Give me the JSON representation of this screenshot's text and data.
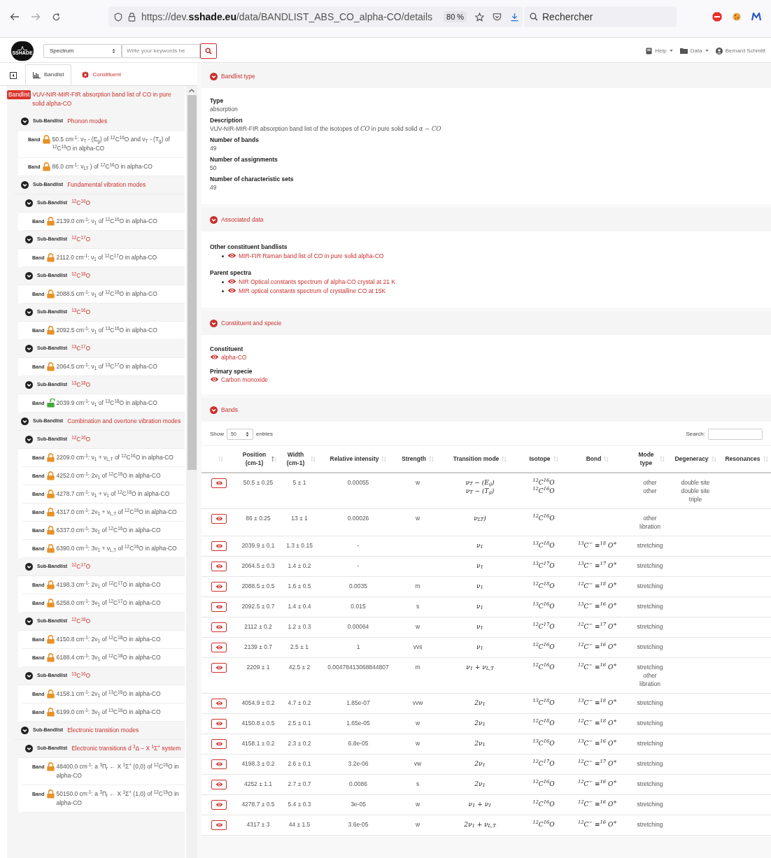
{
  "browser": {
    "url": "https://dev.**sshade.eu**/data/BANDLIST_ABS_CO_alpha-CO/details",
    "zoom": "80 %",
    "search_placeholder": "Rechercher"
  },
  "app_header": {
    "logo_text": "SSHADE",
    "search_scope": "Spectrum",
    "search_placeholder": "Write your keywords he",
    "menus": [
      "Help",
      "Data"
    ],
    "user": "Bernard Schmitt"
  },
  "tabs": [
    {
      "label": "Bandlist",
      "selected": true
    },
    {
      "label": "Constituent",
      "selected": false
    }
  ],
  "sidebar": {
    "root": {
      "kind": "bandlist",
      "label": "Bandlist",
      "title": "VUV-NIR-MIR-FIR absorption band list of CO in pure solid alpha-CO",
      "children": [
        {
          "kind": "subbandlist",
          "label": "Sub-Bandlist",
          "title": "Phonon modes",
          "children": [
            {
              "kind": "band",
              "label": "Band",
              "locked": true,
              "text": "50.5 cm$^{-1}$: ν$_{T}$ - (E$_{g}$) of $^{12}$C$^{16}$O and ν$_{T}$ - (T$_{g}$) of $^{12}$C$^{16}$O in alpha-CO"
            },
            {
              "kind": "band",
              "label": "Band",
              "locked": true,
              "text": "86.0 cm$^{-1}$: ν$_{LT}$ ) of $^{12}$C$^{16}$O in alpha-CO"
            }
          ]
        },
        {
          "kind": "subbandlist",
          "label": "Sub-Bandlist",
          "title": "Fundamental vibration modes",
          "children": [
            {
              "kind": "subbandlist",
              "label": "Sub-Bandlist",
              "title": "$^{12}$C$^{16}$O",
              "children": [
                {
                  "kind": "band",
                  "label": "Band",
                  "locked": true,
                  "text": "2139.0 cm$^{-1}$: ν$_{1}$ of $^{12}$C$^{16}$O in alpha-CO"
                }
              ]
            },
            {
              "kind": "subbandlist",
              "label": "Sub-Bandlist",
              "title": "$^{12}$C$^{17}$O",
              "children": [
                {
                  "kind": "band",
                  "label": "Band",
                  "locked": true,
                  "text": "2112.0 cm$^{-1}$: ν$_{1}$ of $^{12}$C$^{17}$O in alpha-CO"
                }
              ]
            },
            {
              "kind": "subbandlist",
              "label": "Sub-Bandlist",
              "title": "$^{12}$C$^{18}$O",
              "children": [
                {
                  "kind": "band",
                  "label": "Band",
                  "locked": true,
                  "text": "2088.5 cm$^{-1}$: ν$_{1}$ of $^{12}$C$^{18}$O in alpha-CO"
                }
              ]
            },
            {
              "kind": "subbandlist",
              "label": "Sub-Bandlist",
              "title": "$^{13}$C$^{16}$O",
              "children": [
                {
                  "kind": "band",
                  "label": "Band",
                  "locked": true,
                  "text": "2092.5 cm$^{-1}$: ν$_{1}$ of $^{13}$C$^{16}$O in alpha-CO"
                }
              ]
            },
            {
              "kind": "subbandlist",
              "label": "Sub-Bandlist",
              "title": "$^{13}$C$^{17}$O",
              "children": [
                {
                  "kind": "band",
                  "label": "Band",
                  "locked": true,
                  "text": "2064.5 cm$^{-1}$: ν$_{1}$ of $^{13}$C$^{17}$O in alpha-CO"
                }
              ]
            },
            {
              "kind": "subbandlist",
              "label": "Sub-Bandlist",
              "title": "$^{13}$C$^{18}$O",
              "children": [
                {
                  "kind": "band",
                  "label": "Band",
                  "locked": false,
                  "text": "2039.9 cm$^{-1}$: ν$_{1}$ of $^{13}$C$^{18}$O in alpha-CO"
                }
              ]
            }
          ]
        },
        {
          "kind": "subbandlist",
          "label": "Sub-Bandlist",
          "title": "Combination and overtone vibration modes",
          "children": [
            {
              "kind": "subbandlist",
              "label": "Sub-Bandlist",
              "title": "$^{12}$C$^{16}$O",
              "children": [
                {
                  "kind": "band",
                  "label": "Band",
                  "locked": true,
                  "text": "2209.0 cm$^{-1}$: ν$_{1}$ + ν$_{L,T}$ of $^{12}$C$^{16}$O in alpha-CO"
                },
                {
                  "kind": "band",
                  "label": "Band",
                  "locked": true,
                  "text": "4252.0 cm$^{-1}$: 2ν$_{1}$ of $^{12}$C$^{16}$O in alpha-CO"
                },
                {
                  "kind": "band",
                  "label": "Band",
                  "locked": true,
                  "text": "4278.7 cm$^{-1}$: ν$_{1}$ + ν$_{1}$ of $^{12}$C$^{16}$O in alpha-CO"
                },
                {
                  "kind": "band",
                  "label": "Band",
                  "locked": true,
                  "text": "4317.0 cm$^{-1}$: 2ν$_{1}$ + ν$_{L,T}$ of $^{12}$C$^{16}$O in alpha-CO"
                },
                {
                  "kind": "band",
                  "label": "Band",
                  "locked": true,
                  "text": "6337.0 cm$^{-1}$: 3ν$_{1}$ of $^{12}$C$^{16}$O in alpha-CO"
                },
                {
                  "kind": "band",
                  "label": "Band",
                  "locked": true,
                  "text": "6390.0 cm$^{-1}$: 3ν$_{1}$ + ν$_{L,T}$ of $^{12}$C$^{16}$O in alpha-CO"
                }
              ]
            },
            {
              "kind": "subbandlist",
              "label": "Sub-Bandlist",
              "title": "$^{12}$C$^{17}$O",
              "children": [
                {
                  "kind": "band",
                  "label": "Band",
                  "locked": true,
                  "text": "4198.3 cm$^{-1}$: 2ν$_{1}$ of $^{12}$C$^{17}$O in alpha-CO"
                },
                {
                  "kind": "band",
                  "label": "Band",
                  "locked": true,
                  "text": "6258.0 cm$^{-1}$: 3ν$_{1}$ of $^{12}$C$^{17}$O in alpha-CO"
                }
              ]
            },
            {
              "kind": "subbandlist",
              "label": "Sub-Bandlist",
              "title": "$^{12}$C$^{18}$O",
              "children": [
                {
                  "kind": "band",
                  "label": "Band",
                  "locked": true,
                  "text": "4150.8 cm$^{-1}$: 2ν$_{1}$ of $^{12}$C$^{18}$O in alpha-CO"
                },
                {
                  "kind": "band",
                  "label": "Band",
                  "locked": true,
                  "text": "6188.4 cm$^{-1}$: 3ν$_{1}$ of $^{12}$C$^{18}$O in alpha-CO"
                }
              ]
            },
            {
              "kind": "subbandlist",
              "label": "Sub-Bandlist",
              "title": "$^{13}$C$^{16}$O",
              "children": [
                {
                  "kind": "band",
                  "label": "Band",
                  "locked": true,
                  "text": "4158.1 cm$^{-1}$: 2ν$_{1}$ of $^{13}$C$^{16}$O in alpha-CO"
                },
                {
                  "kind": "band",
                  "label": "Band",
                  "locked": true,
                  "text": "6199.0 cm$^{-1}$: 3ν$_{1}$ of $^{13}$C$^{16}$O in alpha-CO"
                }
              ]
            }
          ]
        },
        {
          "kind": "subbandlist",
          "label": "Sub-Bandlist",
          "title": "Electronic transition modes",
          "children": [
            {
              "kind": "subbandlist",
              "label": "Sub-Bandlist",
              "title": "Electronic transitions d $^{3}$Δ − X $^{1}$Σ$^{+}$ system",
              "children": [
                {
                  "kind": "band",
                  "label": "Band",
                  "locked": true,
                  "text": "48400.0 cm$^{-1}$: a $^{3}$Π$_{r}$ ← X $^{1}$Σ$^{+}$ (0,0) of $^{12}$C$^{16}$O in alpha-CO"
                },
                {
                  "kind": "band",
                  "label": "Band",
                  "locked": true,
                  "text": "50150.0 cm$^{-1}$: a $^{3}$Π$_{r}$ ← X $^{1}$Σ$^{+}$ (1,0) of $^{12}$C$^{16}$O in alpha-CO"
                }
              ]
            }
          ]
        }
      ]
    }
  },
  "sections": [
    {
      "kind": "fields",
      "title": "Bandlist type",
      "fields": [
        {
          "label": "Type",
          "value": "absorption"
        },
        {
          "label": "Description",
          "value": "VUV-NIR-MIR-FIR absorption band list of the isotopes of *CO* in pure solid solid *α − CO*"
        },
        {
          "label": "Number of bands",
          "value": "49"
        },
        {
          "label": "Number of assignments",
          "value": "50"
        },
        {
          "label": "Number of characteristic sets",
          "value": "49"
        }
      ]
    },
    {
      "kind": "link_groups",
      "title": "Associated data",
      "groups": [
        {
          "label": "Other constituent bandlists",
          "links": [
            "MIR-FIR Raman band list of CO in pure solid alpha-CO"
          ]
        },
        {
          "label": "Parent spectra",
          "links": [
            "NIR Optical constants spectrum of alpha-CO crystal at 21 K",
            "MIR optical constants spectrum of crystalline CO at 15K"
          ]
        }
      ]
    },
    {
      "kind": "link_fields",
      "title": "Constituent and specie",
      "fields": [
        {
          "label": "Constituent",
          "link": "alpha-CO"
        },
        {
          "label": "Primary specie",
          "link": "Carbon monoxide"
        }
      ]
    },
    {
      "kind": "table",
      "title": "Bands",
      "show_label": "Show",
      "page_length": "50",
      "entries_label": "entries",
      "search_label": "Search:",
      "columns": [
        {
          "sorted": false
        },
        {
          "label": "Position (cm-1)",
          "sorted": true
        },
        {
          "label": "Width (cm-1)",
          "sorted": false
        },
        {
          "label": "Relative intensity",
          "sorted": false
        },
        {
          "label": "Strength",
          "sorted": false
        },
        {
          "label": "Transition mode",
          "sorted": false
        },
        {
          "label": "Isotope",
          "sorted": false
        },
        {
          "label": "Bond",
          "sorted": false
        },
        {
          "label": "Mode type",
          "sorted": false
        },
        {
          "label": "Degeneracy",
          "sorted": false
        },
        {
          "label": "Resonances",
          "sorted": false
        }
      ],
      "rows": [
        {
          "position": [
            "50.5 ± 0.25"
          ],
          "width": [
            "5 ± 1"
          ],
          "intensity": [
            "0.00055"
          ],
          "strength": [
            "w"
          ],
          "transition": [
            "ν$_{T}$ − (E$_{g}$)",
            "ν$_{T}$ − (T$_{g}$)"
          ],
          "isotope": [
            "$^{12}$C$^{16}$O",
            "$^{12}$C$^{16}$O"
          ],
          "mode_type": [
            "other",
            "other"
          ],
          "degeneracy": [
            "double site",
            "double site",
            "triple"
          ]
        },
        {
          "position": [
            "86 ± 0.25"
          ],
          "width": [
            "13 ± 1"
          ],
          "intensity": [
            "0.00026"
          ],
          "strength": [
            "w"
          ],
          "transition": [
            "ν$_{LT}$)"
          ],
          "isotope": [
            "$^{12}$C$^{16}$O"
          ],
          "mode_type": [
            "other",
            "libration"
          ]
        },
        {
          "position": [
            "2039.9 ± 0.1"
          ],
          "width": [
            "1.3 ± 0.15"
          ],
          "intensity": [
            "-"
          ],
          "transition": [
            "ν$_{1}$"
          ],
          "isotope": [
            "$^{13}$C$^{18}$O"
          ],
          "bond": [
            "$^{13}$C$^{−}$ ≡$^{18}$ O$^{+}$"
          ],
          "mode_type": [
            "stretching"
          ]
        },
        {
          "position": [
            "2064.5 ± 0.3"
          ],
          "width": [
            "1.4 ± 0.2"
          ],
          "intensity": [
            "-"
          ],
          "transition": [
            "ν$_{1}$"
          ],
          "isotope": [
            "$^{13}$C$^{17}$O"
          ],
          "bond": [
            "$^{13}$C$^{−}$ ≡$^{17}$ O$^{+}$"
          ],
          "mode_type": [
            "stretching"
          ]
        },
        {
          "position": [
            "2088.5 ± 0.5"
          ],
          "width": [
            "1.6 ± 0.5"
          ],
          "intensity": [
            "0.0035"
          ],
          "strength": [
            "m"
          ],
          "transition": [
            "ν$_{1}$"
          ],
          "isotope": [
            "$^{12}$C$^{18}$O"
          ],
          "bond": [
            "$^{12}$C$^{−}$ ≡$^{18}$ O$^{+}$"
          ],
          "mode_type": [
            "stretching"
          ]
        },
        {
          "position": [
            "2092.5 ± 0.7"
          ],
          "width": [
            "1.4 ± 0.4"
          ],
          "intensity": [
            "0.015"
          ],
          "strength": [
            "s"
          ],
          "transition": [
            "ν$_{1}$"
          ],
          "isotope": [
            "$^{13}$C$^{16}$O"
          ],
          "bond": [
            "$^{13}$C$^{−}$ ≡$^{16}$ O$^{+}$"
          ],
          "mode_type": [
            "stretching"
          ]
        },
        {
          "position": [
            "2112 ± 0.2"
          ],
          "width": [
            "1.2 ± 0.3"
          ],
          "intensity": [
            "0.00064"
          ],
          "strength": [
            "w"
          ],
          "transition": [
            "ν$_{1}$"
          ],
          "isotope": [
            "$^{12}$C$^{17}$O"
          ],
          "bond": [
            "$^{12}$C$^{−}$ ≡$^{17}$ O$^{+}$"
          ],
          "mode_type": [
            "stretching"
          ]
        },
        {
          "position": [
            "2139 ± 0.7"
          ],
          "width": [
            "2.5 ± 1"
          ],
          "intensity": [
            "1"
          ],
          "strength": [
            "vvs"
          ],
          "transition": [
            "ν$_{1}$"
          ],
          "isotope": [
            "$^{12}$C$^{16}$O"
          ],
          "bond": [
            "$^{12}$C$^{−}$ ≡$^{16}$ O$^{+}$"
          ],
          "mode_type": [
            "stretching"
          ]
        },
        {
          "position": [
            "2209 ± 1"
          ],
          "width": [
            "42.5 ± 2"
          ],
          "intensity": [
            "0.00478413068844807"
          ],
          "strength": [
            "m"
          ],
          "transition": [
            "ν$_{1}$ + ν$_{L,T}$"
          ],
          "isotope": [
            "$^{12}$C$^{16}$O"
          ],
          "bond": [
            "$^{12}$C$^{−}$ ≡$^{16}$ O$^{+}$"
          ],
          "mode_type": [
            "stretching",
            "other",
            "libration"
          ]
        },
        {
          "position": [
            "4054.9 ± 0.2"
          ],
          "width": [
            "4.7 ± 0.2"
          ],
          "intensity": [
            "1.85e-07"
          ],
          "strength": [
            "vvw"
          ],
          "transition": [
            "2ν$_{1}$"
          ],
          "isotope": [
            "$^{13}$C$^{18}$O"
          ],
          "bond": [
            "$^{13}$C$^{−}$ ≡$^{18}$ O$^{+}$"
          ],
          "mode_type": [
            "stretching"
          ]
        },
        {
          "position": [
            "4150.8 ± 0.5"
          ],
          "width": [
            "2.5 ± 0.1"
          ],
          "intensity": [
            "1.65e-05"
          ],
          "strength": [
            "w"
          ],
          "transition": [
            "2ν$_{1}$"
          ],
          "isotope": [
            "$^{12}$C$^{18}$O"
          ],
          "bond": [
            "$^{12}$C$^{−}$ ≡$^{18}$ O$^{+}$"
          ],
          "mode_type": [
            "stretching"
          ]
        },
        {
          "position": [
            "4158.1 ± 0.2"
          ],
          "width": [
            "2.3 ± 0.2"
          ],
          "intensity": [
            "6.8e-05"
          ],
          "strength": [
            "w"
          ],
          "transition": [
            "2ν$_{1}$"
          ],
          "isotope": [
            "$^{13}$C$^{16}$O"
          ],
          "bond": [
            "$^{13}$C$^{−}$ ≡$^{16}$ O$^{+}$"
          ],
          "mode_type": [
            "stretching"
          ]
        },
        {
          "position": [
            "4198.3 ± 0.2"
          ],
          "width": [
            "2.6 ± 0.1"
          ],
          "intensity": [
            "3.2e-06"
          ],
          "strength": [
            "vw"
          ],
          "transition": [
            "2ν$_{1}$"
          ],
          "isotope": [
            "$^{12}$C$^{17}$O"
          ],
          "bond": [
            "$^{12}$C$^{−}$ ≡$^{17}$ O$^{+}$"
          ],
          "mode_type": [
            "stretching"
          ]
        },
        {
          "position": [
            "4252 ± 1.1"
          ],
          "width": [
            "2.7 ± 0.7"
          ],
          "intensity": [
            "0.0086"
          ],
          "strength": [
            "s"
          ],
          "transition": [
            "2ν$_{1}$"
          ],
          "isotope": [
            "$^{12}$C$^{16}$O"
          ],
          "bond": [
            "$^{12}$C$^{−}$ ≡$^{16}$ O$^{+}$"
          ],
          "mode_type": [
            "stretching"
          ]
        },
        {
          "position": [
            "4278.7 ± 0.5"
          ],
          "width": [
            "5.4 ± 0.3"
          ],
          "intensity": [
            "3e-05"
          ],
          "strength": [
            "w"
          ],
          "transition": [
            "ν$_{1}$ + ν$_{1}$"
          ],
          "isotope": [
            "$^{12}$C$^{16}$O"
          ],
          "bond": [
            "$^{12}$C$^{−}$ ≡$^{16}$ O$^{+}$"
          ],
          "mode_type": [
            "stretching"
          ]
        },
        {
          "position": [
            "4317 ± 3"
          ],
          "width": [
            "44 ± 1.5"
          ],
          "intensity": [
            "3.6e-05"
          ],
          "strength": [
            "w"
          ],
          "transition": [
            "2ν$_{1}$ + ν$_{L,T}$"
          ],
          "isotope": [
            "$^{12}$C$^{16}$O"
          ],
          "bond": [
            "$^{12}$C$^{−}$ ≡$^{16}$ O$^{+}$"
          ],
          "mode_type": [
            "stretching"
          ]
        }
      ]
    }
  ]
}
